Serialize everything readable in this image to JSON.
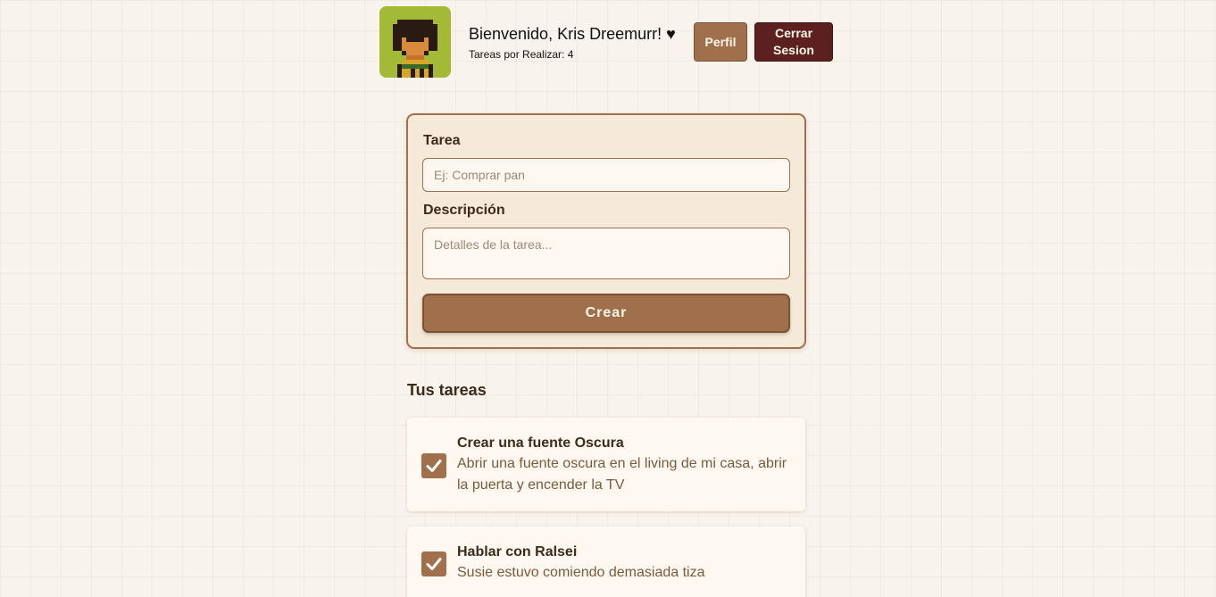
{
  "header": {
    "welcome": "Bienvenido, Kris Dreemurr! ♥",
    "pending": "Tareas por Realizar: 4",
    "perfil_label": "Perfil",
    "logout_line1": "Cerrar",
    "logout_line2": "Sesion"
  },
  "form": {
    "title_label": "Tarea",
    "title_placeholder": "Ej: Comprar pan",
    "desc_label": "Descripción",
    "desc_placeholder": "Detalles de la tarea...",
    "submit_label": "Crear"
  },
  "tasks_section": {
    "heading": "Tus tareas",
    "items": [
      {
        "title": "Crear una fuente Oscura",
        "description": "Abrir una fuente oscura en el living de mi casa, abrir la puerta y encender la TV",
        "checked": true
      },
      {
        "title": "Hablar con Ralsei",
        "description": "Susie estuvo comiendo demasiada tiza",
        "checked": true
      }
    ]
  },
  "colors": {
    "accent": "#a0704c",
    "logout": "#5c2020",
    "avatar_bg": "#a3ba36",
    "background": "#f8f3ec"
  }
}
